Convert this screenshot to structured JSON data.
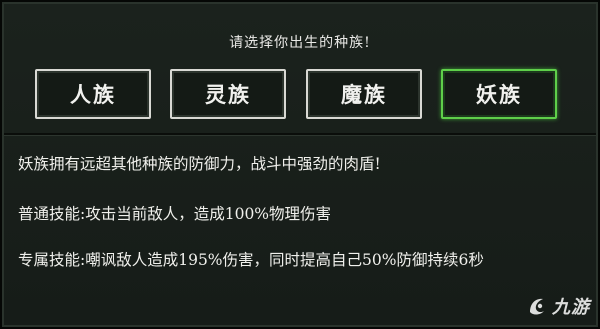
{
  "prompt": "请选择你出生的种族!",
  "races": [
    {
      "label": "人族",
      "selected": false
    },
    {
      "label": "灵族",
      "selected": false
    },
    {
      "label": "魔族",
      "selected": false
    },
    {
      "label": "妖族",
      "selected": true
    }
  ],
  "description": "妖族拥有远超其他种族的防御力，战斗中强劲的肉盾!",
  "skills": {
    "normal": "普通技能:攻击当前敌人，造成100%物理伤害",
    "exclusive": "专属技能:嘲讽敌人造成195%伤害，同时提高自己50%防御持续6秒"
  },
  "watermark": {
    "text": "九游",
    "icon": "jiuyou-logo-icon"
  },
  "colors": {
    "background": "#1b221d",
    "selected_border": "#5fcf4a",
    "button_border": "#d9d9d4",
    "text": "#f0f0ec"
  }
}
